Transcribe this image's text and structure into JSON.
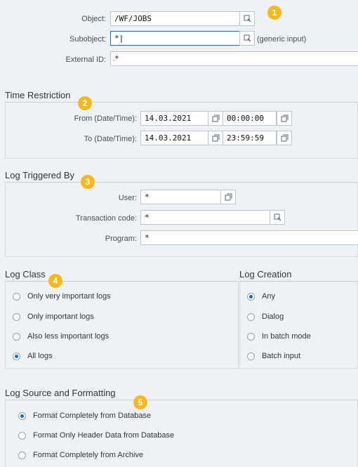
{
  "selection": {
    "object_label": "Object:",
    "object_value": "/WF/JOBS",
    "subobject_label": "Subobject:",
    "subobject_value": "*|",
    "subobject_hint": "(generic input)",
    "external_id_label": "External ID:",
    "external_id_value": "*"
  },
  "time_restriction": {
    "title": "Time Restriction",
    "from_label": "From (Date/Time):",
    "from_date": "14.03.2021",
    "from_time": "00:00:00",
    "to_label": "To (Date/Time):",
    "to_date": "14.03.2021",
    "to_time": "23:59:59"
  },
  "log_triggered_by": {
    "title": "Log Triggered By",
    "user_label": "User:",
    "user_value": "*",
    "transaction_label": "Transaction code:",
    "transaction_value": "*",
    "program_label": "Program:",
    "program_value": "*"
  },
  "log_class": {
    "title": "Log Class",
    "options": [
      "Only very important logs",
      "Only important logs",
      "Also less important logs",
      "All logs"
    ],
    "selected": "All logs"
  },
  "log_creation": {
    "title": "Log Creation",
    "options": [
      "Any",
      "Dialog",
      "In batch mode",
      "Batch input"
    ],
    "selected": "Any"
  },
  "log_source": {
    "title": "Log Source and Formatting",
    "options": [
      "Format Completely from Database",
      "Format Only Header Data from Database",
      "Format Completely from Archive"
    ],
    "selected": "Format Completely from Database"
  },
  "badges": [
    "1",
    "2",
    "3",
    "4",
    "5"
  ],
  "icons": {
    "value_help": "value-help-icon",
    "calendar": "calendar-icon"
  },
  "colors": {
    "badge": "#f6b81d",
    "accent": "#0a6ed1"
  }
}
